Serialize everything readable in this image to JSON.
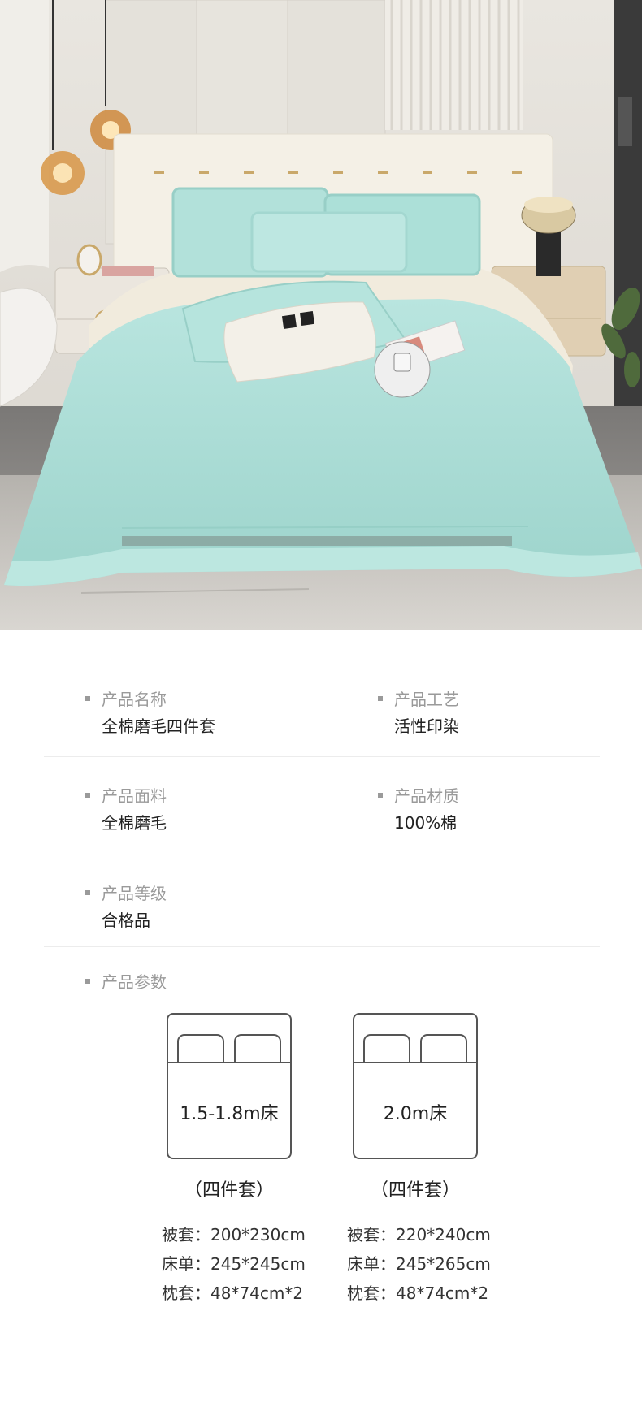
{
  "properties": [
    {
      "label": "产品名称",
      "value": "全棉磨毛四件套"
    },
    {
      "label": "产品工艺",
      "value": "活性印染"
    },
    {
      "label": "产品面料",
      "value": "全棉磨毛"
    },
    {
      "label": "产品材质",
      "value": "100%棉"
    },
    {
      "label": "产品等级",
      "value": "合格品"
    }
  ],
  "params_label": "产品参数",
  "beds": [
    {
      "size": "1.5-1.8m床",
      "set": "（四件套）",
      "specs": [
        "被套：200*230cm",
        "床单：245*245cm",
        "枕套：48*74cm*2"
      ]
    },
    {
      "size": "2.0m床",
      "set": "（四件套）",
      "specs": [
        "被套：220*240cm",
        "床单：245*265cm",
        "枕套：48*74cm*2"
      ]
    }
  ],
  "colors": {
    "duvet": "#a9ddd6",
    "sheet": "#f1ebdd",
    "bullet": "#9a9a9a",
    "label": "#9a9a9a"
  }
}
